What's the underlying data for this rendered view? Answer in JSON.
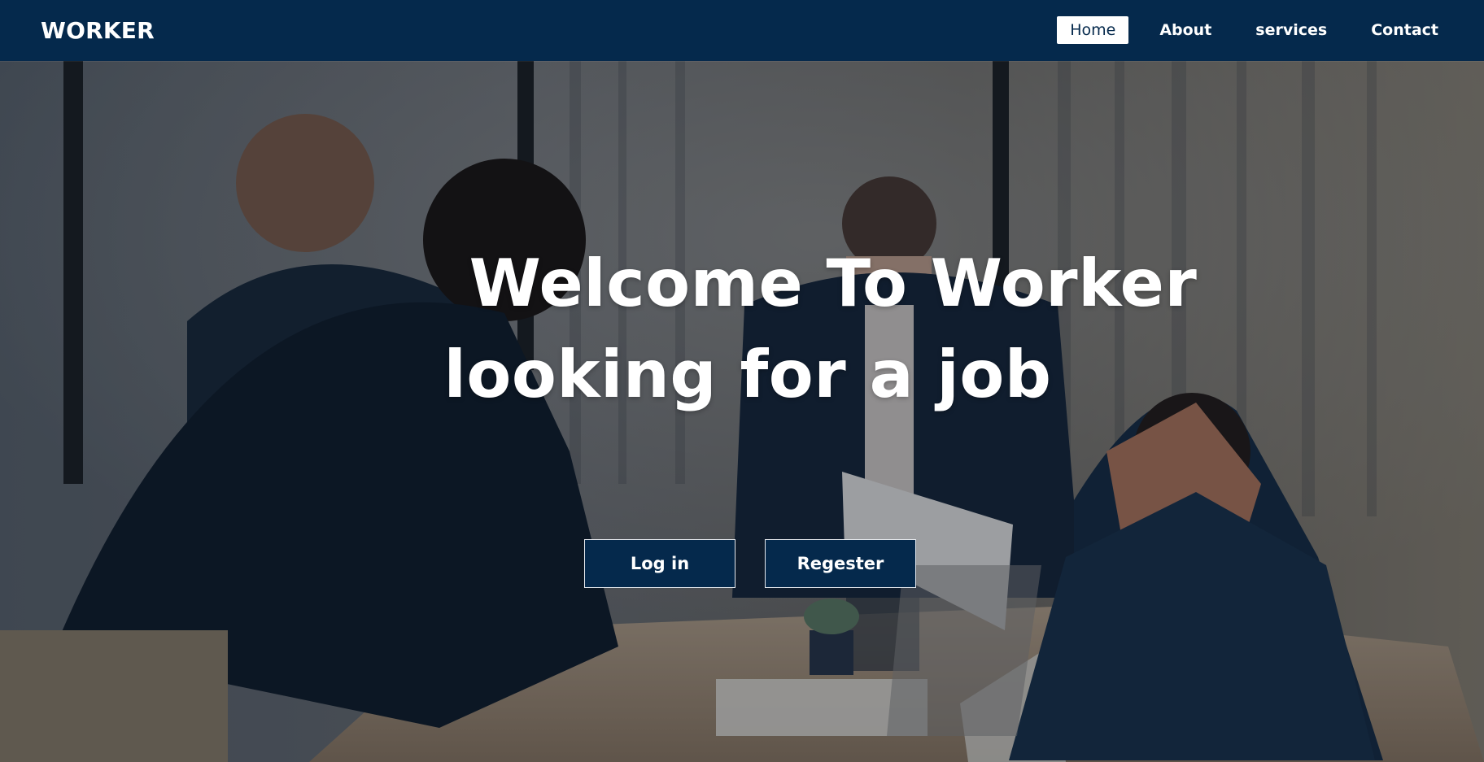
{
  "navbar": {
    "brand": "WORKER",
    "links": [
      {
        "label": "Home",
        "active": true
      },
      {
        "label": "About",
        "active": false
      },
      {
        "label": "services",
        "active": false
      },
      {
        "label": "Contact",
        "active": false
      }
    ],
    "background_color": "#05294c",
    "active_link_background": "#ffffff"
  },
  "hero": {
    "title_line1": "Welcome To Worker",
    "title_line2": "looking for a job",
    "buttons": {
      "login_label": "Log in",
      "register_label": "Regester"
    },
    "background_image": "office team meeting photo",
    "button_color": "#05294c"
  }
}
